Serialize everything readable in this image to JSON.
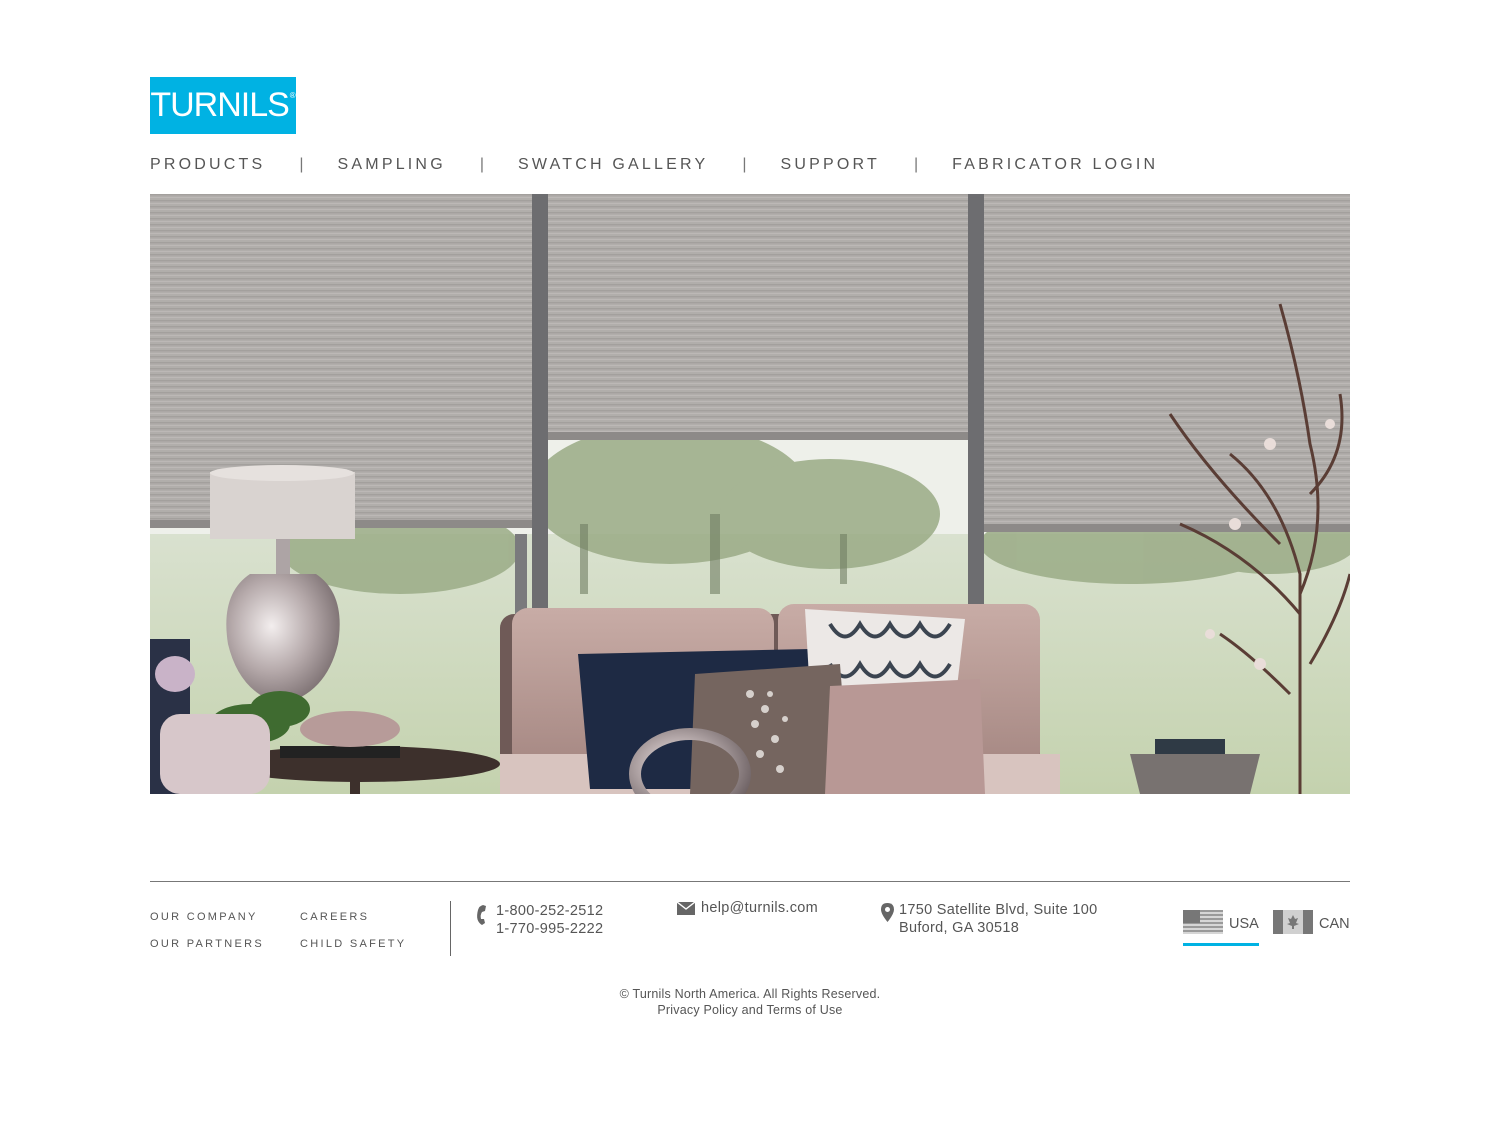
{
  "logo": {
    "text": "TURNILS",
    "mark": "®",
    "brand_color": "#00b2e3"
  },
  "nav": {
    "items": [
      {
        "label": "PRODUCTS"
      },
      {
        "label": "SAMPLING"
      },
      {
        "label": "SWATCH GALLERY"
      },
      {
        "label": "SUPPORT"
      },
      {
        "label": "FABRICATOR LOGIN"
      }
    ],
    "separator": "|"
  },
  "hero": {
    "subject": "cellular shades living room photo"
  },
  "footer": {
    "links_col1": [
      {
        "label": "OUR COMPANY"
      },
      {
        "label": "OUR PARTNERS"
      }
    ],
    "links_col2": [
      {
        "label": "CAREERS"
      },
      {
        "label": "CHILD SAFETY"
      }
    ],
    "phone": {
      "icon": "phone-icon",
      "line1": "1-800-252-2512",
      "line2": "1-770-995-2222"
    },
    "email": {
      "icon": "mail-icon",
      "address": "help@turnils.com"
    },
    "address": {
      "icon": "map-pin-icon",
      "line1": "1750 Satellite Blvd, Suite 100",
      "line2": "Buford, GA 30518"
    },
    "countries": [
      {
        "label": "USA",
        "icon": "us-flag-icon",
        "selected": true
      },
      {
        "label": "CAN",
        "icon": "canada-flag-icon",
        "selected": false
      }
    ],
    "copyright": "© Turnils North America. All Rights Reserved.",
    "legal_link": "Privacy Policy and Terms of Use"
  }
}
